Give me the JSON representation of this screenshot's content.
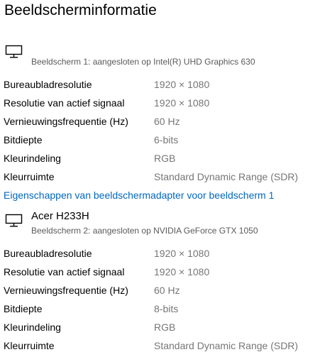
{
  "page": {
    "title": "Beeldscherminformatie"
  },
  "displays": [
    {
      "icon": "monitor-icon",
      "name": "",
      "connection": "Beeldscherm 1: aangesloten op Intel(R) UHD Graphics 630",
      "rows": [
        {
          "label": "Bureaubladresolutie",
          "value": "1920 × 1080"
        },
        {
          "label": "Resolutie van actief signaal",
          "value": "1920 × 1080"
        },
        {
          "label": "Vernieuwingsfrequentie (Hz)",
          "value": "60 Hz"
        },
        {
          "label": "Bitdiepte",
          "value": "6-bits"
        },
        {
          "label": "Kleurindeling",
          "value": "RGB"
        },
        {
          "label": "Kleurruimte",
          "value": "Standard Dynamic Range (SDR)"
        }
      ],
      "adapter_link": "Eigenschappen van beeldschermadapter voor beeldscherm 1"
    },
    {
      "icon": "monitor-icon",
      "name": "Acer H233H",
      "connection": "Beeldscherm 2: aangesloten op NVIDIA GeForce GTX 1050",
      "rows": [
        {
          "label": "Bureaubladresolutie",
          "value": "1920 × 1080"
        },
        {
          "label": "Resolutie van actief signaal",
          "value": "1920 × 1080"
        },
        {
          "label": "Vernieuwingsfrequentie (Hz)",
          "value": "60 Hz"
        },
        {
          "label": "Bitdiepte",
          "value": "8-bits"
        },
        {
          "label": "Kleurindeling",
          "value": "RGB"
        },
        {
          "label": "Kleurruimte",
          "value": "Standard Dynamic Range (SDR)"
        }
      ]
    }
  ],
  "colors": {
    "link": "#0067c0",
    "value_text": "#767676",
    "secondary_text": "#5a5a5a"
  }
}
